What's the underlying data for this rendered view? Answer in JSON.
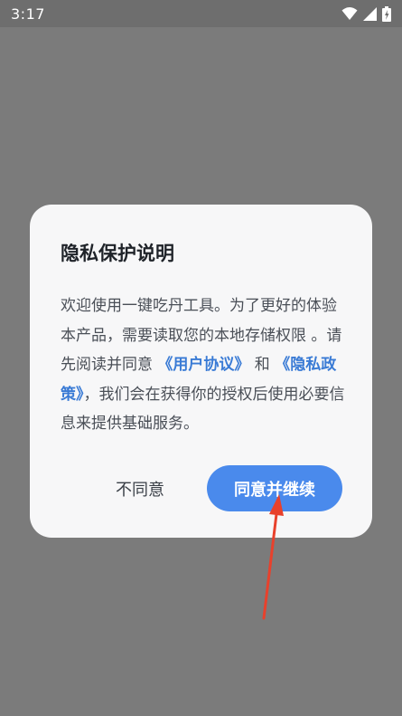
{
  "status_bar": {
    "time": "3:17",
    "icons": [
      "wifi-icon",
      "cell-signal-icon",
      "battery-icon"
    ]
  },
  "dialog": {
    "title": "隐私保护说明",
    "body": {
      "intro": "欢迎使用一键吃丹工具。为了更好的体验本产品，需要读取您的本地存储权限 。请先阅读并同意 ",
      "user_agreement_link": "《用户协议》",
      "connector": " 和 ",
      "privacy_policy_link": "《隐私政策》",
      "outro": "，我们会在获得你的授权后使用必要信息来提供基础服务。"
    },
    "buttons": {
      "disagree_label": "不同意",
      "agree_label": "同意并继续"
    }
  },
  "colors": {
    "overlay": "#7b7b7b",
    "dialog_bg": "#f7f7f8",
    "link": "#3a7bd5",
    "primary_button": "#4a8aec",
    "annotation_arrow": "#e8412c"
  }
}
